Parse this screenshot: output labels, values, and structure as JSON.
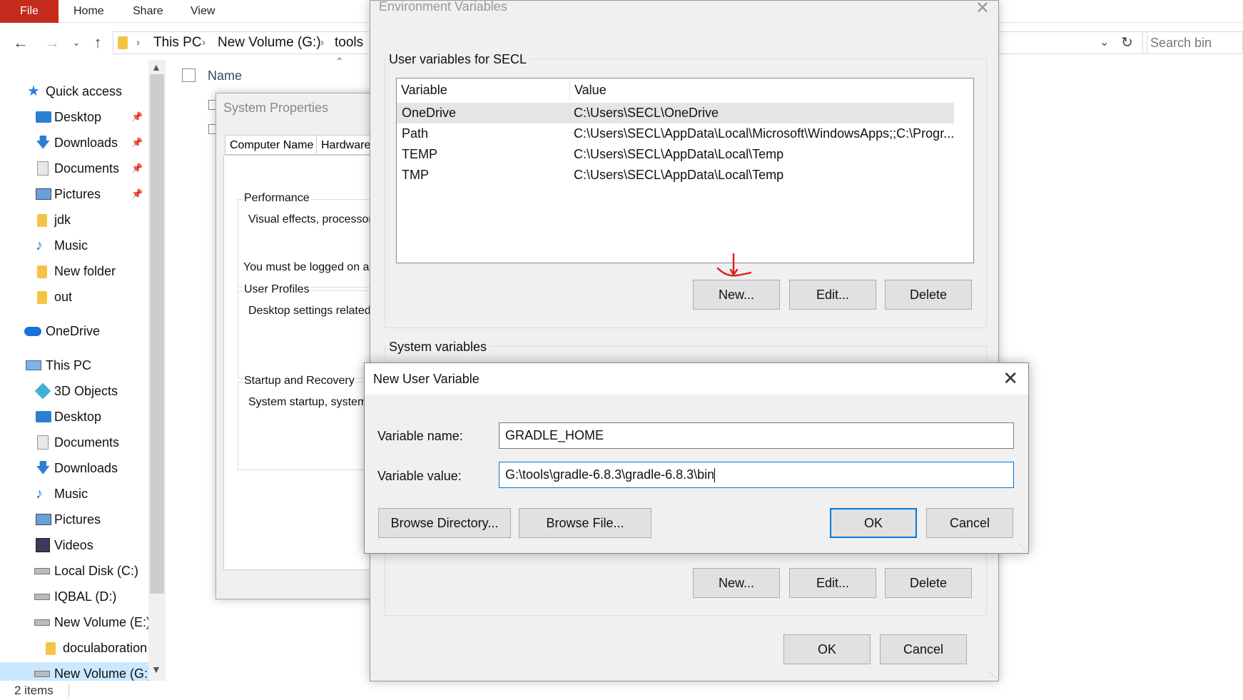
{
  "ribbon": {
    "file": "File",
    "tabs": [
      "Home",
      "Share",
      "View"
    ]
  },
  "address": {
    "crumbs": [
      "This PC",
      "New Volume (G:)",
      "tools"
    ],
    "search_placeholder": "Search bin"
  },
  "nav": {
    "quick_access": "Quick access",
    "quick_items": [
      "Desktop",
      "Downloads",
      "Documents",
      "Pictures",
      "jdk",
      "Music",
      "New folder",
      "out"
    ],
    "onedrive": "OneDrive",
    "this_pc": "This PC",
    "pc_items": [
      "3D Objects",
      "Desktop",
      "Documents",
      "Downloads",
      "Music",
      "Pictures",
      "Videos",
      "Local Disk (C:)",
      "IQBAL (D:)",
      "New Volume (E:)",
      "doculaboration",
      "New Volume (G:)"
    ]
  },
  "filelist": {
    "name_header": "Name",
    "status": "2 items"
  },
  "system_properties": {
    "title": "System Properties",
    "tabs": [
      "Computer Name",
      "Hardware"
    ],
    "intro": "You must be logged on as",
    "performance_label": "Performance",
    "performance_text": "Visual effects, processor",
    "profiles_label": "User Profiles",
    "profiles_text": "Desktop settings related",
    "startup_label": "Startup and Recovery",
    "startup_text": "System startup, system"
  },
  "env_vars": {
    "title": "Environment Variables",
    "user_group": "User variables for SECL",
    "columns": [
      "Variable",
      "Value"
    ],
    "user_rows": [
      {
        "variable": "OneDrive",
        "value": "C:\\Users\\SECL\\OneDrive"
      },
      {
        "variable": "Path",
        "value": "C:\\Users\\SECL\\AppData\\Local\\Microsoft\\WindowsApps;;C:\\Progr..."
      },
      {
        "variable": "TEMP",
        "value": "C:\\Users\\SECL\\AppData\\Local\\Temp"
      },
      {
        "variable": "TMP",
        "value": "C:\\Users\\SECL\\AppData\\Local\\Temp"
      }
    ],
    "new": "New...",
    "edit": "Edit...",
    "delete": "Delete",
    "system_group": "System variables",
    "ok": "OK",
    "cancel": "Cancel"
  },
  "new_user_variable": {
    "title": "New User Variable",
    "name_label": "Variable name:",
    "name_value": "GRADLE_HOME",
    "value_label": "Variable value:",
    "value_value": "G:\\tools\\gradle-6.8.3\\gradle-6.8.3\\bin",
    "browse_directory": "Browse Directory...",
    "browse_file": "Browse File...",
    "ok": "OK",
    "cancel": "Cancel"
  },
  "colors": {
    "file_tab": "#c42b1c",
    "focus_blue": "#0078d7",
    "annotation_red": "#e02020",
    "dialog_bg": "#f0f0f0"
  }
}
